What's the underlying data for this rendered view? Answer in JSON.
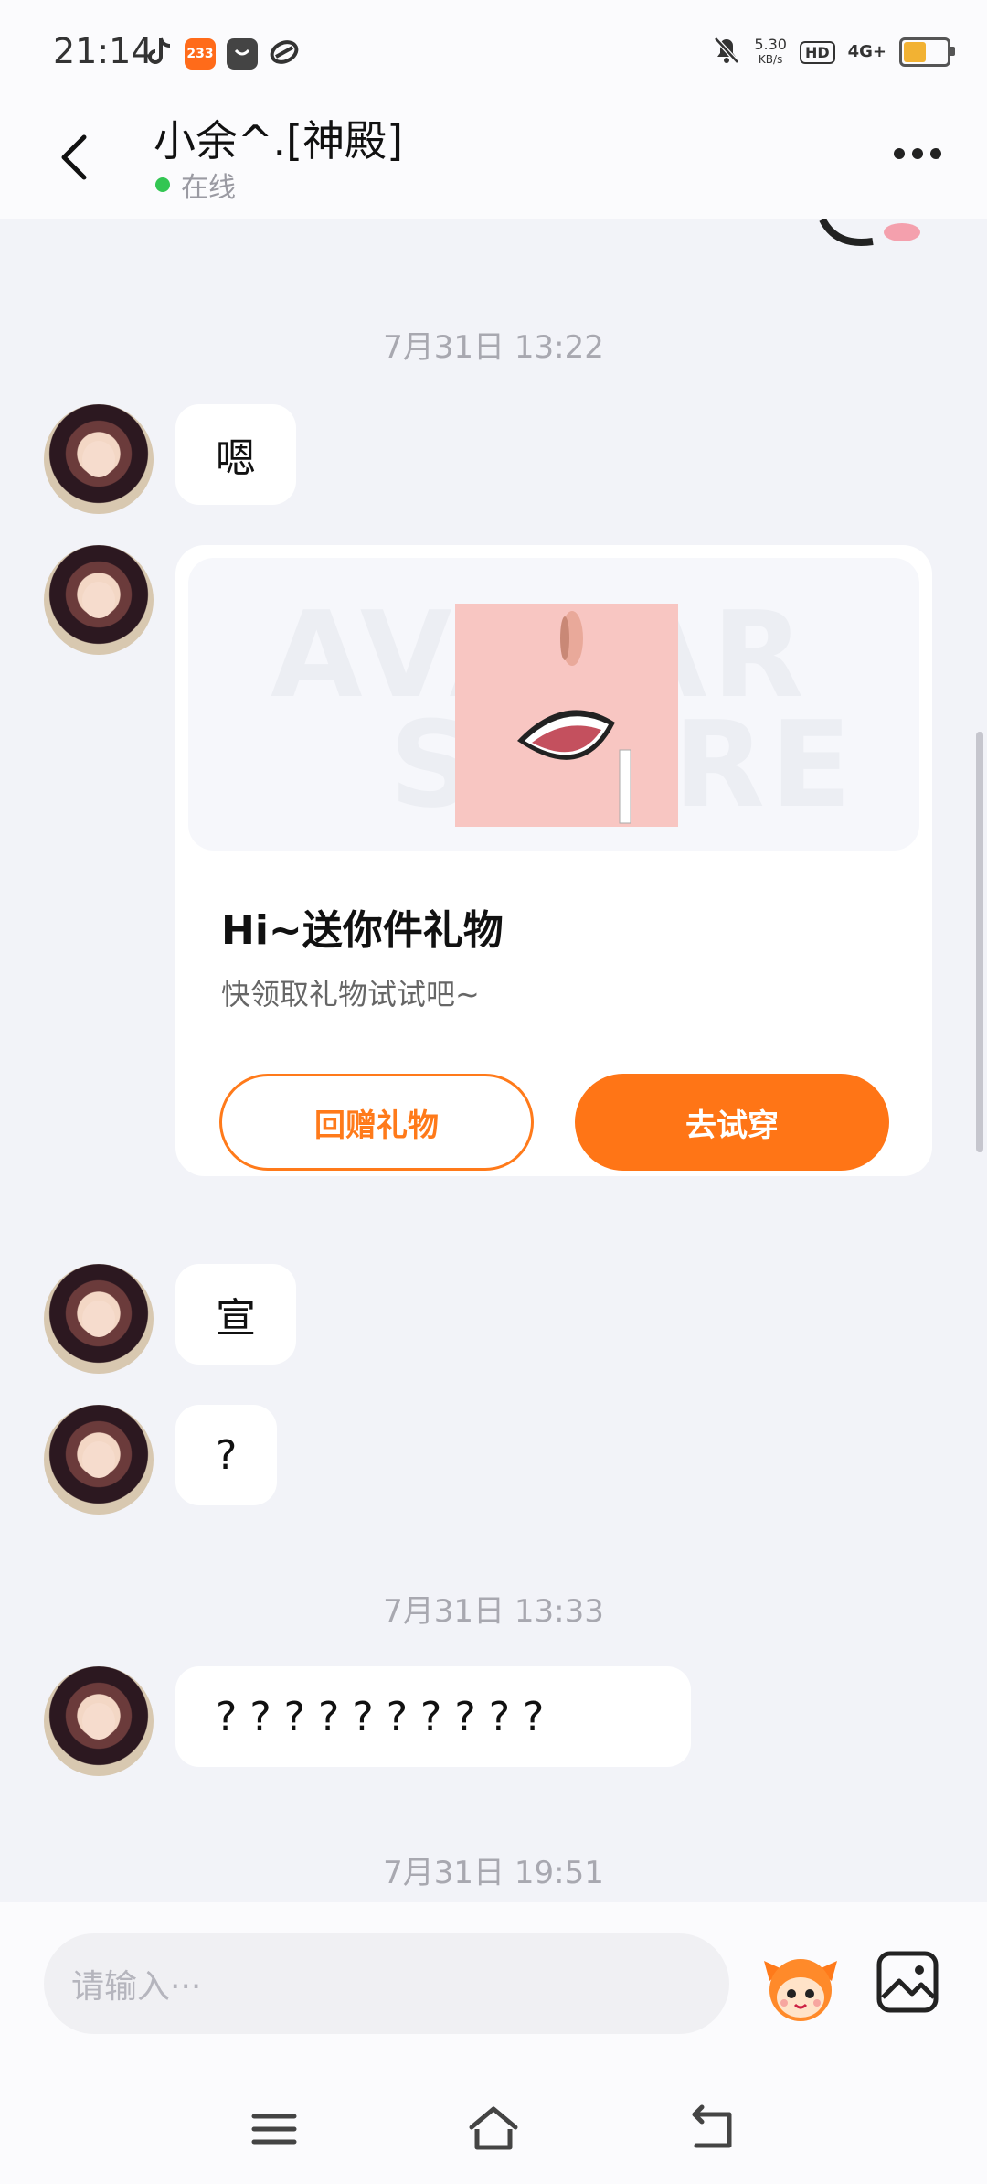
{
  "status_bar": {
    "time": "21:14",
    "app_icons": [
      "tiktok-icon",
      "233-app-icon",
      "bag-app-icon",
      "link-app-icon"
    ],
    "app_badge_text": "233",
    "speed_value": "5.30",
    "speed_unit": "KB/s",
    "hd_label": "HD",
    "network_label": "4G+",
    "battery_level": 0.55
  },
  "header": {
    "title": "小余^.[神殿]",
    "status": "在线",
    "status_color": "#33c653"
  },
  "chat": {
    "messages": [
      {
        "type": "timestamp",
        "text": "7月31日 13:22"
      },
      {
        "type": "text",
        "text": "嗯"
      },
      {
        "type": "gift_card",
        "title": "Hi~送你件礼物",
        "subtitle": "快领取礼物试试吧~",
        "secondary_button": "回赠礼物",
        "primary_button": "去试穿"
      },
      {
        "type": "text",
        "text": "宣"
      },
      {
        "type": "text",
        "text": "?"
      },
      {
        "type": "timestamp",
        "text": "7月31日 13:33"
      },
      {
        "type": "text",
        "text": "? ? ? ? ? ? ? ? ? ?"
      },
      {
        "type": "timestamp",
        "text": "7月31日 19:51"
      }
    ],
    "watermark": [
      "AVATAR",
      "STORE"
    ]
  },
  "input_bar": {
    "placeholder": "请输入···",
    "emoji_icon": "mascot-emoji-icon",
    "image_icon": "image-icon"
  },
  "colors": {
    "accent": "#ff7516",
    "background": "#f2f3f8"
  }
}
